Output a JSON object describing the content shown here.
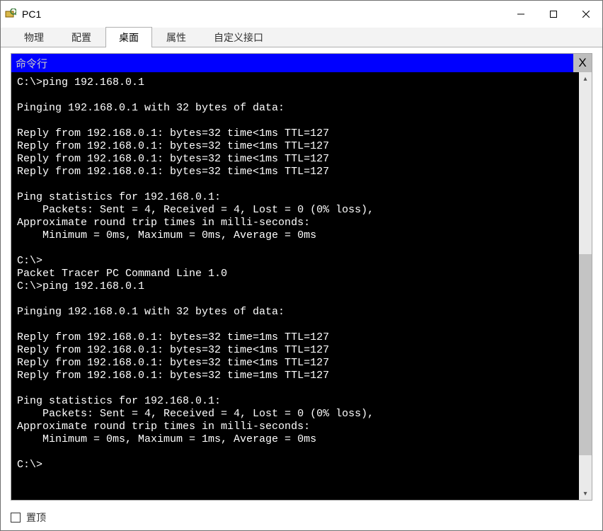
{
  "titlebar": {
    "title": "PC1"
  },
  "tabs": {
    "t0": "物理",
    "t1": "配置",
    "t2": "桌面",
    "t3": "属性",
    "t4": "自定义接口"
  },
  "panel": {
    "title": "命令行",
    "close": "X"
  },
  "scroll": {
    "up": "▴",
    "down": "▾"
  },
  "footer": {
    "top_label": "置顶"
  },
  "terminal": {
    "content": "C:\\>ping 192.168.0.1\n\nPinging 192.168.0.1 with 32 bytes of data:\n\nReply from 192.168.0.1: bytes=32 time<1ms TTL=127\nReply from 192.168.0.1: bytes=32 time<1ms TTL=127\nReply from 192.168.0.1: bytes=32 time<1ms TTL=127\nReply from 192.168.0.1: bytes=32 time<1ms TTL=127\n\nPing statistics for 192.168.0.1:\n    Packets: Sent = 4, Received = 4, Lost = 0 (0% loss),\nApproximate round trip times in milli-seconds:\n    Minimum = 0ms, Maximum = 0ms, Average = 0ms\n\nC:\\>\nPacket Tracer PC Command Line 1.0\nC:\\>ping 192.168.0.1\n\nPinging 192.168.0.1 with 32 bytes of data:\n\nReply from 192.168.0.1: bytes=32 time=1ms TTL=127\nReply from 192.168.0.1: bytes=32 time<1ms TTL=127\nReply from 192.168.0.1: bytes=32 time<1ms TTL=127\nReply from 192.168.0.1: bytes=32 time=1ms TTL=127\n\nPing statistics for 192.168.0.1:\n    Packets: Sent = 4, Received = 4, Lost = 0 (0% loss),\nApproximate round trip times in milli-seconds:\n    Minimum = 0ms, Maximum = 1ms, Average = 0ms\n\nC:\\>"
  }
}
